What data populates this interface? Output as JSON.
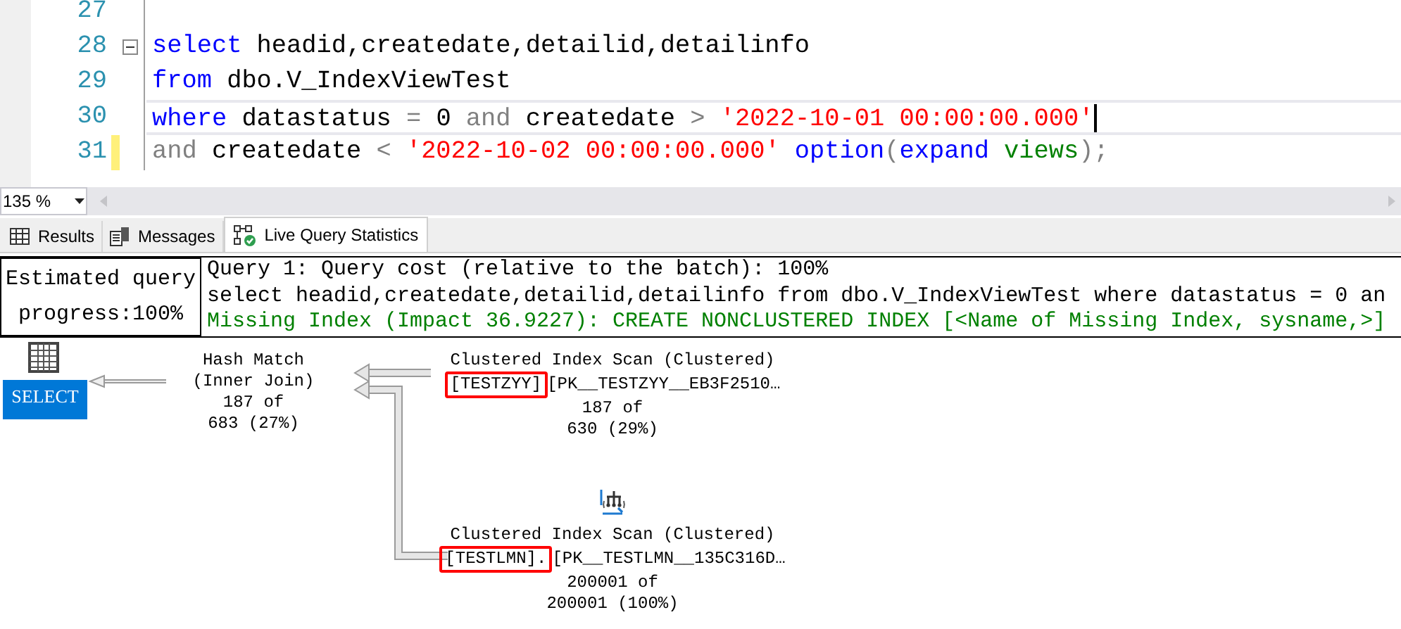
{
  "editor": {
    "lines": [
      {
        "number": "27",
        "collapsible": false,
        "changed": false,
        "current": false
      },
      {
        "number": "28",
        "collapsible": true,
        "changed": false,
        "current": false,
        "tokens": [
          {
            "kind": "keyword",
            "text": "select"
          },
          {
            "kind": "plain",
            "text": " headid,createdate,detailid,detailinfo"
          }
        ]
      },
      {
        "number": "29",
        "collapsible": false,
        "changed": false,
        "current": false,
        "tokens": [
          {
            "kind": "keyword",
            "text": "from"
          },
          {
            "kind": "plain",
            "text": " dbo.V_IndexViewTest"
          }
        ]
      },
      {
        "number": "30",
        "collapsible": false,
        "changed": false,
        "current": true,
        "tokens": [
          {
            "kind": "keyword",
            "text": "where"
          },
          {
            "kind": "plain",
            "text": " datastatus "
          },
          {
            "kind": "operator",
            "text": "="
          },
          {
            "kind": "plain",
            "text": " 0 "
          },
          {
            "kind": "operator",
            "text": "and"
          },
          {
            "kind": "plain",
            "text": " createdate "
          },
          {
            "kind": "operator",
            "text": "> "
          },
          {
            "kind": "string",
            "text": "'2022-10-01 00:00:00.000'"
          }
        ]
      },
      {
        "number": "31",
        "collapsible": false,
        "changed": true,
        "current": false,
        "tokens": [
          {
            "kind": "operator",
            "text": "and"
          },
          {
            "kind": "plain",
            "text": " createdate "
          },
          {
            "kind": "operator",
            "text": "< "
          },
          {
            "kind": "string",
            "text": "'2022-10-02 00:00:00.000'"
          },
          {
            "kind": "keyword",
            "text": " option"
          },
          {
            "kind": "operator",
            "text": "("
          },
          {
            "kind": "keyword",
            "text": "expand"
          },
          {
            "kind": "builtin",
            "text": " views"
          },
          {
            "kind": "operator",
            "text": ")"
          },
          {
            "kind": "operator",
            "text": ";"
          }
        ]
      }
    ]
  },
  "zoom": {
    "value": "135 %"
  },
  "tabs": [
    {
      "label": "Results",
      "selected": false
    },
    {
      "label": "Messages",
      "selected": false
    },
    {
      "label": "Live Query Statistics",
      "selected": true
    }
  ],
  "plan": {
    "progress": [
      "Estimated query",
      "progress:100%"
    ],
    "header": [
      {
        "kind": "info",
        "text": "Query 1: Query cost (relative to the batch): 100%"
      },
      {
        "kind": "statement",
        "text": "select headid,createdate,detailid,detailinfo from dbo.V_IndexViewTest where datastatus = 0 an"
      },
      {
        "kind": "missing_index",
        "text": "Missing Index (Impact 36.9227): CREATE NONCLUSTERED INDEX [<Name of Missing Index, sysname,>]"
      }
    ],
    "nodes": [
      {
        "kind": "select",
        "label": "SELECT",
        "selected": true
      },
      {
        "kind": "operator",
        "lines": [
          "Hash Match",
          "(Inner Join)",
          "187 of",
          "683 (27%)"
        ]
      },
      {
        "kind": "scan",
        "show_icon": false,
        "title": "Clustered Index Scan (Clustered)",
        "object": "[TESTZYY]",
        "index": "[PK__TESTZYY__EB3F2510…",
        "rows": [
          "187 of",
          "630 (29%)"
        ],
        "highlighted": true
      },
      {
        "kind": "scan",
        "show_icon": true,
        "title": "Clustered Index Scan (Clustered)",
        "object": "[TESTLMN].",
        "index": "[PK__TESTLMN__135C316D…",
        "rows": [
          "200001 of",
          "200001 (100%)"
        ],
        "highlighted": true
      }
    ]
  }
}
